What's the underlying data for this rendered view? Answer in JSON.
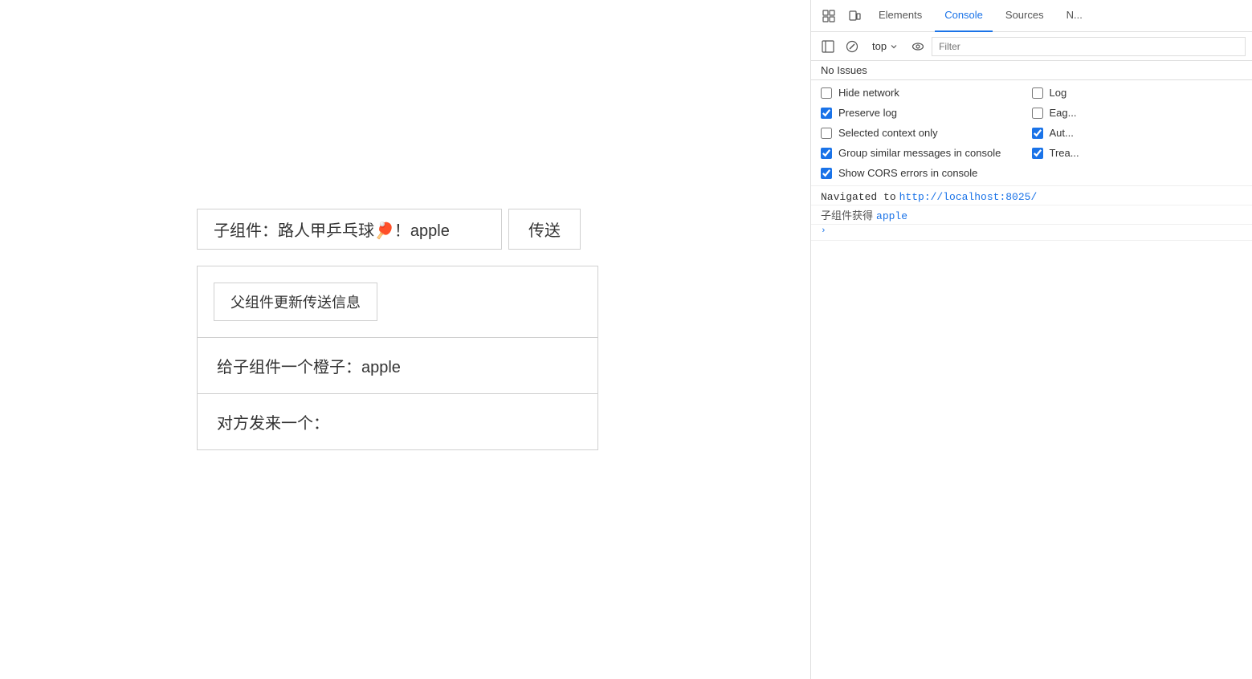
{
  "main": {
    "child_component": {
      "label": "子组件：路人甲乒乓球🏓！apple",
      "send_button": "传送"
    },
    "parent_box": {
      "update_button": "父组件更新传送信息",
      "orange_label": "给子组件一个橙子：apple",
      "received_label": "对方发来一个："
    }
  },
  "devtools": {
    "tabs": [
      {
        "id": "elements",
        "label": "Elements",
        "active": false
      },
      {
        "id": "console",
        "label": "Console",
        "active": true
      },
      {
        "id": "sources",
        "label": "Sources",
        "active": false
      },
      {
        "id": "network",
        "label": "N...",
        "active": false
      }
    ],
    "toolbar": {
      "top_label": "top",
      "filter_placeholder": "Filter"
    },
    "no_issues": "No Issues",
    "settings": [
      {
        "id": "hide-network",
        "label": "Hide network",
        "checked": false
      },
      {
        "id": "log",
        "label": "Log",
        "checked": false
      },
      {
        "id": "preserve-log",
        "label": "Preserve log",
        "checked": true
      },
      {
        "id": "eag",
        "label": "Eag...",
        "checked": false
      },
      {
        "id": "selected-context",
        "label": "Selected context only",
        "checked": false
      },
      {
        "id": "aut",
        "label": "Aut...",
        "checked": true
      },
      {
        "id": "group-similar",
        "label": "Group similar messages in console",
        "checked": true
      },
      {
        "id": "trea",
        "label": "Trea...",
        "checked": true
      },
      {
        "id": "show-cors",
        "label": "Show CORS errors in console",
        "checked": true
      }
    ],
    "console_output": [
      {
        "type": "navigate",
        "text": "Navigated to ",
        "link": "http://localhost:8025/"
      },
      {
        "type": "log",
        "prefix": "子组件获得",
        "value": "apple"
      },
      {
        "type": "prompt"
      }
    ]
  }
}
